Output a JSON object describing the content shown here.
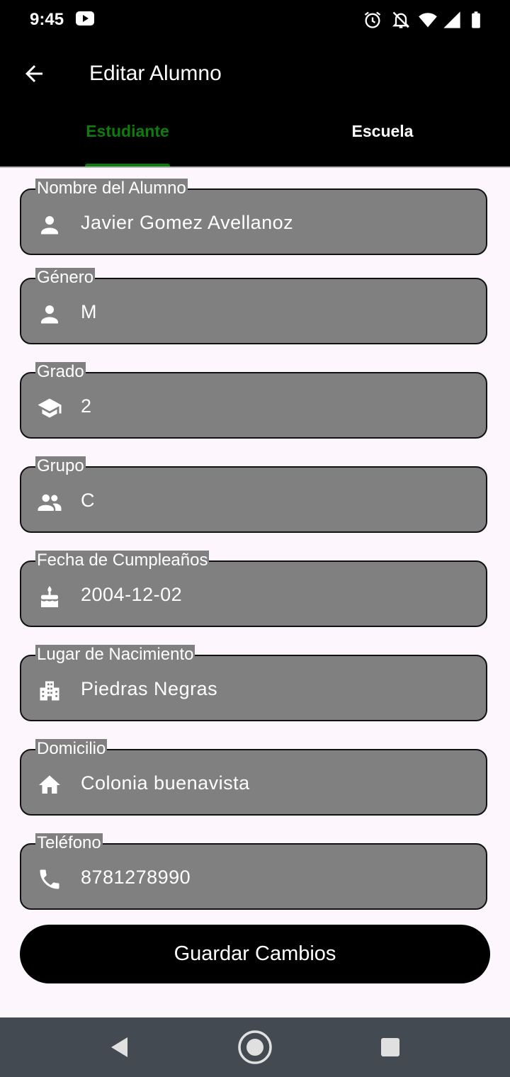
{
  "status": {
    "time": "9:45"
  },
  "header": {
    "title": "Editar Alumno"
  },
  "tabs": [
    {
      "label": "Estudiante",
      "active": true
    },
    {
      "label": "Escuela",
      "active": false
    }
  ],
  "fields": [
    {
      "label": "Nombre del Alumno",
      "value": "Javier Gomez Avellanoz",
      "icon": "person-icon"
    },
    {
      "label": "Género",
      "value": "M",
      "icon": "person-icon"
    },
    {
      "label": "Grado",
      "value": "2",
      "icon": "school-icon"
    },
    {
      "label": "Grupo",
      "value": "C",
      "icon": "group-icon"
    },
    {
      "label": "Fecha de Cumpleaños",
      "value": "2004-12-02",
      "icon": "cake-icon"
    },
    {
      "label": "Lugar de Nacimiento",
      "value": "Piedras Negras",
      "icon": "city-icon"
    },
    {
      "label": "Domicilio",
      "value": "Colonia buenavista",
      "icon": "home-icon"
    },
    {
      "label": "Teléfono",
      "value": "8781278990",
      "icon": "phone-icon"
    }
  ],
  "actions": {
    "save_label": "Guardar Cambios"
  },
  "colors": {
    "accent": "#0c7d0c",
    "field_background": "#808080",
    "app_bar": "#000000",
    "page_background": "#fdf7fd",
    "nav_bar": "#444a52"
  }
}
